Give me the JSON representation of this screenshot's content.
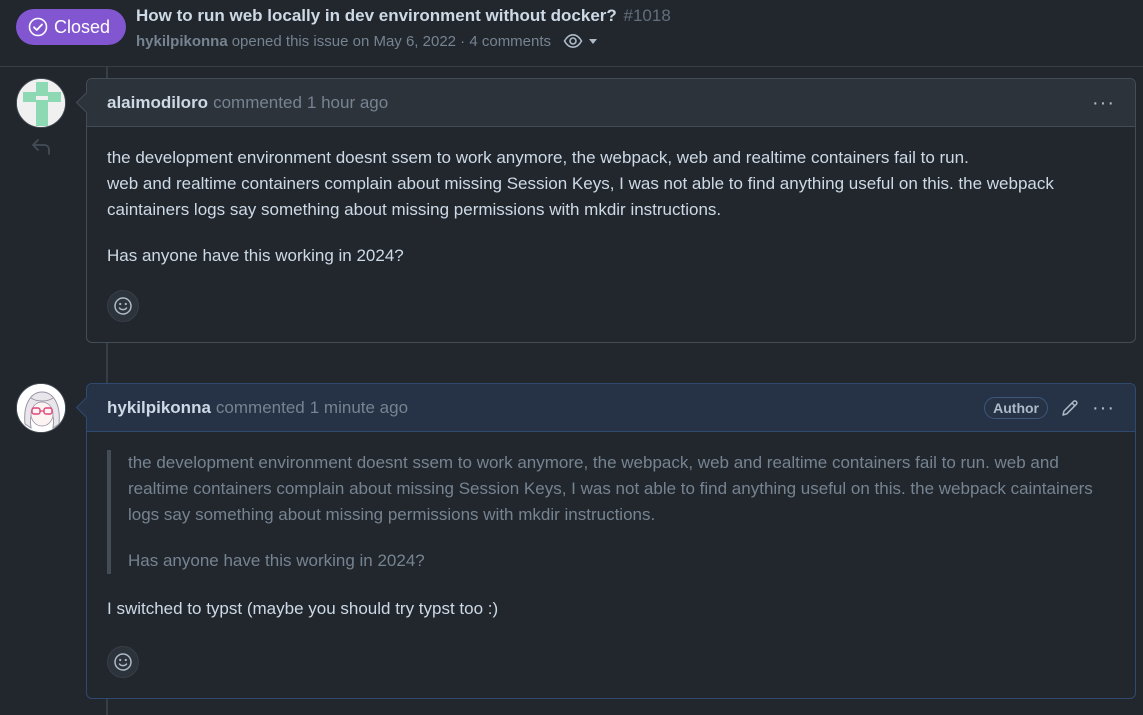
{
  "issue": {
    "state": "Closed",
    "title": "How to run web locally in dev environment without docker?",
    "number": "#1018",
    "author": "hykilpikonna",
    "opened_text": "opened this issue on May 6, 2022 · 4 comments"
  },
  "comments": [
    {
      "login": "alaimodiloro",
      "action": "commented",
      "time": "1 hour ago",
      "paragraphs": [
        "the development environment doesnt ssem to work anymore, the webpack, web and realtime containers fail to run.",
        "web and realtime containers complain about missing Session Keys, I was not able to find anything useful on this. the webpack caintainers logs say something about missing permissions with mkdir instructions.",
        "Has anyone have this working in 2024?"
      ]
    },
    {
      "login": "hykilpikonna",
      "action": "commented",
      "time": "1 minute ago",
      "badge": "Author",
      "quote": [
        "the development environment doesnt ssem to work anymore, the webpack, web and realtime containers fail to run. web and realtime containers complain about missing Session Keys, I was not able to find anything useful on this. the webpack caintainers logs say something about missing permissions with mkdir instructions.",
        "Has anyone have this working in 2024?"
      ],
      "reply": "I switched to typst (maybe you should try typst too :)"
    }
  ],
  "icons": {
    "state": "check-circle-icon",
    "subscribe": "eye-icon",
    "menu": "kebab-icon",
    "edit": "pencil-icon",
    "reaction": "smiley-icon",
    "reply": "reply-arrow-icon"
  },
  "colors": {
    "background": "#22272e",
    "closed_badge": "#8256d0",
    "author_border": "#2f4a6e"
  }
}
